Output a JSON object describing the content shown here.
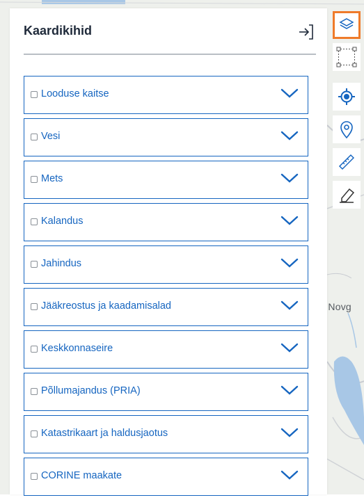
{
  "panel": {
    "title": "Kaardikihid"
  },
  "layers": [
    {
      "label": "Looduse kaitse",
      "checked": false
    },
    {
      "label": "Vesi",
      "checked": false
    },
    {
      "label": "Mets",
      "checked": false
    },
    {
      "label": "Kalandus",
      "checked": false
    },
    {
      "label": "Jahindus",
      "checked": false
    },
    {
      "label": "Jääkreostus ja kaadamisalad",
      "checked": false
    },
    {
      "label": "Keskkonnaseire",
      "checked": false
    },
    {
      "label": "Põllumajandus (PRIA)",
      "checked": false
    },
    {
      "label": "Katastrikaart ja haldusjaotus",
      "checked": false
    },
    {
      "label": "CORINE maakate",
      "checked": false
    }
  ],
  "map": {
    "place_label": "i Novg"
  },
  "toolbar": {
    "tools": [
      "layers-icon",
      "select-area-icon",
      "locate-icon",
      "pin-icon",
      "measure-icon",
      "eraser-icon"
    ],
    "active": "layers-icon"
  },
  "colors": {
    "accent": "#1565c0",
    "active_border": "#ef7b2a",
    "title": "#1f2a3a"
  }
}
